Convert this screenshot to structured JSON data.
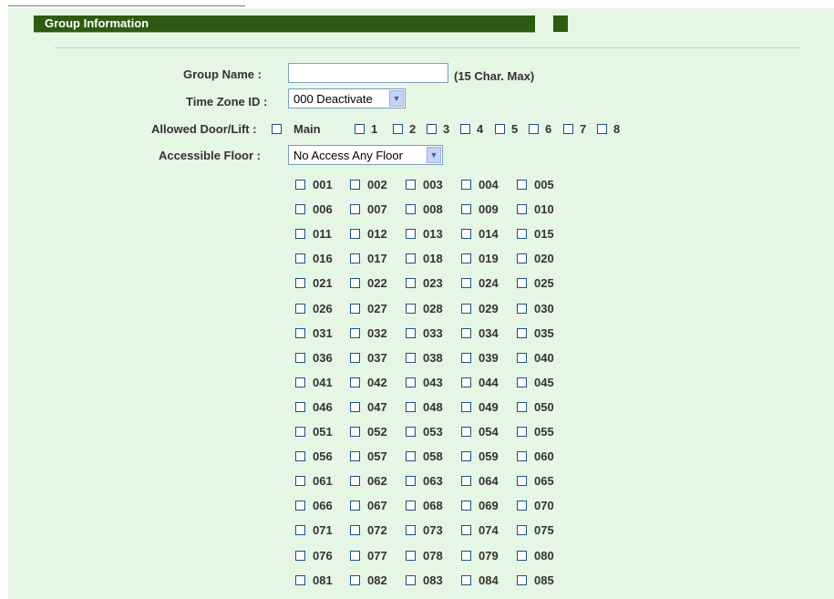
{
  "header": {
    "title": "Group Information"
  },
  "form": {
    "group_name": {
      "label": "Group Name  :",
      "value": "",
      "hint": "(15 Char. Max)"
    },
    "time_zone": {
      "label": "Time Zone ID  :",
      "selected": "000 Deactivate"
    },
    "allowed_door": {
      "label": "Allowed Door/Lift :",
      "options": [
        "Main",
        "1",
        "2",
        "3",
        "4",
        "5",
        "6",
        "7",
        "8"
      ]
    },
    "accessible_floor": {
      "label": "Accessible Floor :",
      "selected": "No Access Any Floor"
    },
    "floors": [
      "001",
      "002",
      "003",
      "004",
      "005",
      "006",
      "007",
      "008",
      "009",
      "010",
      "011",
      "012",
      "013",
      "014",
      "015",
      "016",
      "017",
      "018",
      "019",
      "020",
      "021",
      "022",
      "023",
      "024",
      "025",
      "026",
      "027",
      "028",
      "029",
      "030",
      "031",
      "032",
      "033",
      "034",
      "035",
      "036",
      "037",
      "038",
      "039",
      "040",
      "041",
      "042",
      "043",
      "044",
      "045",
      "046",
      "047",
      "048",
      "049",
      "050",
      "051",
      "052",
      "053",
      "054",
      "055",
      "056",
      "057",
      "058",
      "059",
      "060",
      "061",
      "062",
      "063",
      "064",
      "065",
      "066",
      "067",
      "068",
      "069",
      "070",
      "071",
      "072",
      "073",
      "074",
      "075",
      "076",
      "077",
      "078",
      "079",
      "080",
      "081",
      "082",
      "083",
      "084",
      "085"
    ]
  },
  "colors": {
    "accent": "#2d5b13",
    "panel_bg": "#e5f6e4"
  }
}
